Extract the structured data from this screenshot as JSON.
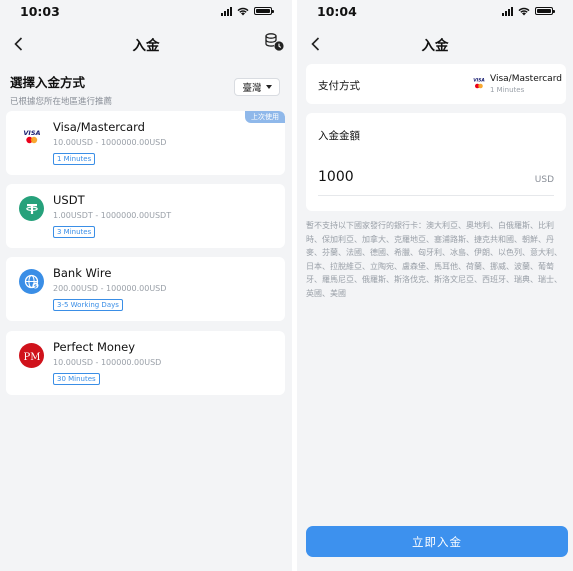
{
  "left": {
    "status": {
      "time": "10:03"
    },
    "nav": {
      "title": "入金"
    },
    "section": {
      "title": "選擇入金方式",
      "subtitle": "已根據您所在地區進行推薦",
      "region": "臺灣"
    },
    "methods": [
      {
        "name": "Visa/Mastercard",
        "range": "10.00USD - 1000000.00USD",
        "time": "1 Minutes",
        "icon": "visa-mastercard-icon",
        "badge": "上次使用"
      },
      {
        "name": "USDT",
        "range": "1.00USDT - 1000000.00USDT",
        "time": "3 Minutes",
        "icon": "tether-icon"
      },
      {
        "name": "Bank Wire",
        "range": "200.00USD - 100000.00USD",
        "time": "3-5 Working Days",
        "icon": "bank-wire-icon"
      },
      {
        "name": "Perfect Money",
        "range": "10.00USD - 100000.00USD",
        "time": "30 Minutes",
        "icon": "perfect-money-icon"
      }
    ]
  },
  "right": {
    "status": {
      "time": "10:04"
    },
    "nav": {
      "title": "入金"
    },
    "payment": {
      "label": "支付方式",
      "method": "Visa/Mastercard",
      "time": "1 Minutes"
    },
    "amount": {
      "label": "入金金額",
      "value": "1000",
      "unit": "USD"
    },
    "notice": "暫不支持以下國家發行的銀行卡：澳大利亞、奧地利、白俄羅斯、比利時、保加利亞、加拿大、克羅地亞、塞浦路斯、捷克共和國、朝鮮、丹麥、芬蘭、法國、德國、希臘、匈牙利、冰島、伊朗、以色列、意大利、日本、拉脫維亞、立陶宛、盧森堡、馬耳他、荷蘭、挪威、波蘭、葡萄牙、羅馬尼亞、俄羅斯、斯洛伐克、斯洛文尼亞、西班牙、瑞典、瑞士、英國、美國",
    "submit": "立即入金"
  },
  "colors": {
    "accent": "#3d91ee",
    "tag": "#3a8ee6",
    "tether": "#26a17b",
    "pm_red": "#d0121b"
  }
}
